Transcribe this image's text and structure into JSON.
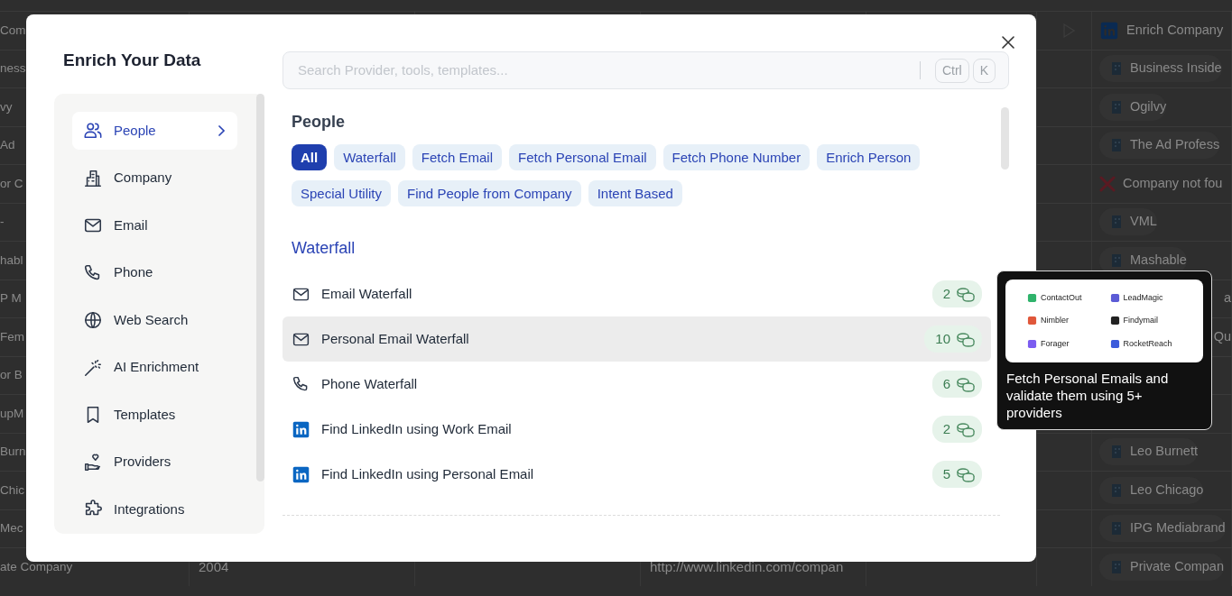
{
  "background_table": {
    "rows": [
      {
        "column_1": "Com",
        "column_7": {
          "kind": "header",
          "text": "Enrich Company"
        }
      },
      {
        "column_1": "ness",
        "column_7": {
          "kind": "company",
          "text": "Business Inside"
        }
      },
      {
        "column_1": "vy",
        "column_7": {
          "kind": "company",
          "text": "Ogilvy"
        }
      },
      {
        "column_1": "Ad",
        "column_7": {
          "kind": "company",
          "text": "The Ad Profess"
        }
      },
      {
        "column_1": "or C",
        "column_7": {
          "kind": "not_found",
          "text": "Company not fou"
        }
      },
      {
        "column_1": "-",
        "column_7": {
          "kind": "company",
          "text": "VML"
        }
      },
      {
        "column_1": "habl",
        "column_7": {
          "kind": "company",
          "text": "Mashable"
        }
      },
      {
        "column_1": "P M",
        "column_7": {
          "kind": "partial",
          "text": "a"
        }
      },
      {
        "column_1": "Fem",
        "column_7": {
          "kind": "partial",
          "text": "Qu"
        }
      },
      {
        "column_1": "or B"
      },
      {
        "column_1": "upM"
      },
      {
        "column_1": "Burn",
        "column_7": {
          "kind": "company",
          "text": "Leo Burnett"
        }
      },
      {
        "column_1": "Chic",
        "column_7": {
          "kind": "company",
          "text": "Leo Chicago"
        }
      },
      {
        "column_1": "Mec",
        "column_7": {
          "kind": "company",
          "text": "IPG Mediabrand"
        }
      },
      {
        "column_1": "ate Company",
        "column_2": "2004",
        "column_4": "http://www.linkedin.com/compan",
        "column_7": {
          "kind": "company",
          "text": "Private Compan"
        }
      }
    ]
  },
  "modal": {
    "title": "Enrich Your Data",
    "sidebar": {
      "items": [
        {
          "label": "People",
          "kind": "people",
          "selected": true
        },
        {
          "label": "Company",
          "kind": "building",
          "selected": false
        },
        {
          "label": "Email",
          "kind": "email",
          "selected": false
        },
        {
          "label": "Phone",
          "kind": "phone",
          "selected": false
        },
        {
          "label": "Web Search",
          "kind": "globe",
          "selected": false
        },
        {
          "label": "AI Enrichment",
          "kind": "wand",
          "selected": false
        },
        {
          "label": "Templates",
          "kind": "bookmark",
          "selected": false
        },
        {
          "label": "Providers",
          "kind": "hand",
          "selected": false
        },
        {
          "label": "Integrations",
          "kind": "puzzle",
          "selected": false
        }
      ]
    },
    "search": {
      "placeholder": "Search Provider, tools, templates...",
      "shortcut": [
        "Ctrl",
        "K"
      ]
    },
    "section": {
      "title": "People",
      "filters": [
        {
          "label": "All",
          "selected": true
        },
        {
          "label": "Waterfall",
          "selected": false
        },
        {
          "label": "Fetch Email",
          "selected": false
        },
        {
          "label": "Fetch Personal Email",
          "selected": false
        },
        {
          "label": "Fetch Phone Number",
          "selected": false
        },
        {
          "label": "Enrich Person",
          "selected": false
        },
        {
          "label": "Special Utility",
          "selected": false
        },
        {
          "label": "Find People from Company",
          "selected": false
        },
        {
          "label": "Intent Based",
          "selected": false
        }
      ]
    },
    "groups": [
      {
        "title": "Waterfall",
        "items": [
          {
            "label": "Email Waterfall",
            "kind": "email",
            "count": "2",
            "selected": false
          },
          {
            "label": "Personal Email Waterfall",
            "kind": "email",
            "count": "10",
            "selected": true
          },
          {
            "label": "Phone Waterfall",
            "kind": "phone",
            "count": "6",
            "selected": false
          },
          {
            "label": "Find LinkedIn using Work Email",
            "kind": "linkedin",
            "count": "2",
            "selected": false
          },
          {
            "label": "Find LinkedIn using Personal Email",
            "kind": "linkedin",
            "count": "5",
            "selected": false
          }
        ]
      }
    ]
  },
  "tooltip": {
    "providers": [
      {
        "name": "ContactOut",
        "color": "#2fb36b"
      },
      {
        "name": "LeadMagic",
        "color": "#5b5bd6"
      },
      {
        "name": "Nimbler",
        "color": "#e0573a"
      },
      {
        "name": "Findymail",
        "color": "#222222"
      },
      {
        "name": "Forager",
        "color": "#7b5cf0"
      },
      {
        "name": "RocketReach",
        "color": "#3b5bdb"
      }
    ],
    "text": "Fetch Personal Emails and validate them using 5+ providers"
  }
}
